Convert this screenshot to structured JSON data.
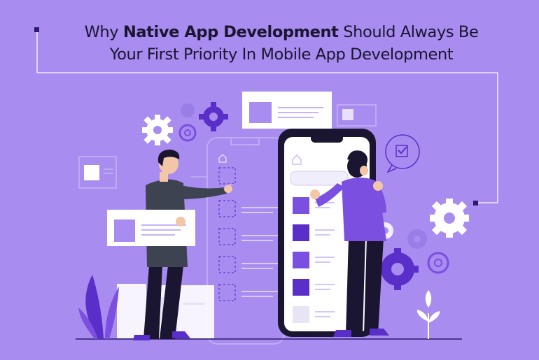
{
  "headline": {
    "prefix": "Why ",
    "emphasis": "Native App Development",
    "suffix": " Should Always Be",
    "line2": "Your First Priority In Mobile App Development"
  },
  "colors": {
    "background": "#a88cf0",
    "accent_dark": "#5a2ec8",
    "accent": "#7b4fe0",
    "accent_light": "#c7b3f7",
    "ink": "#1a1530"
  },
  "icons": [
    "gear-icon",
    "home-icon",
    "checklist-icon",
    "plant-icon"
  ]
}
